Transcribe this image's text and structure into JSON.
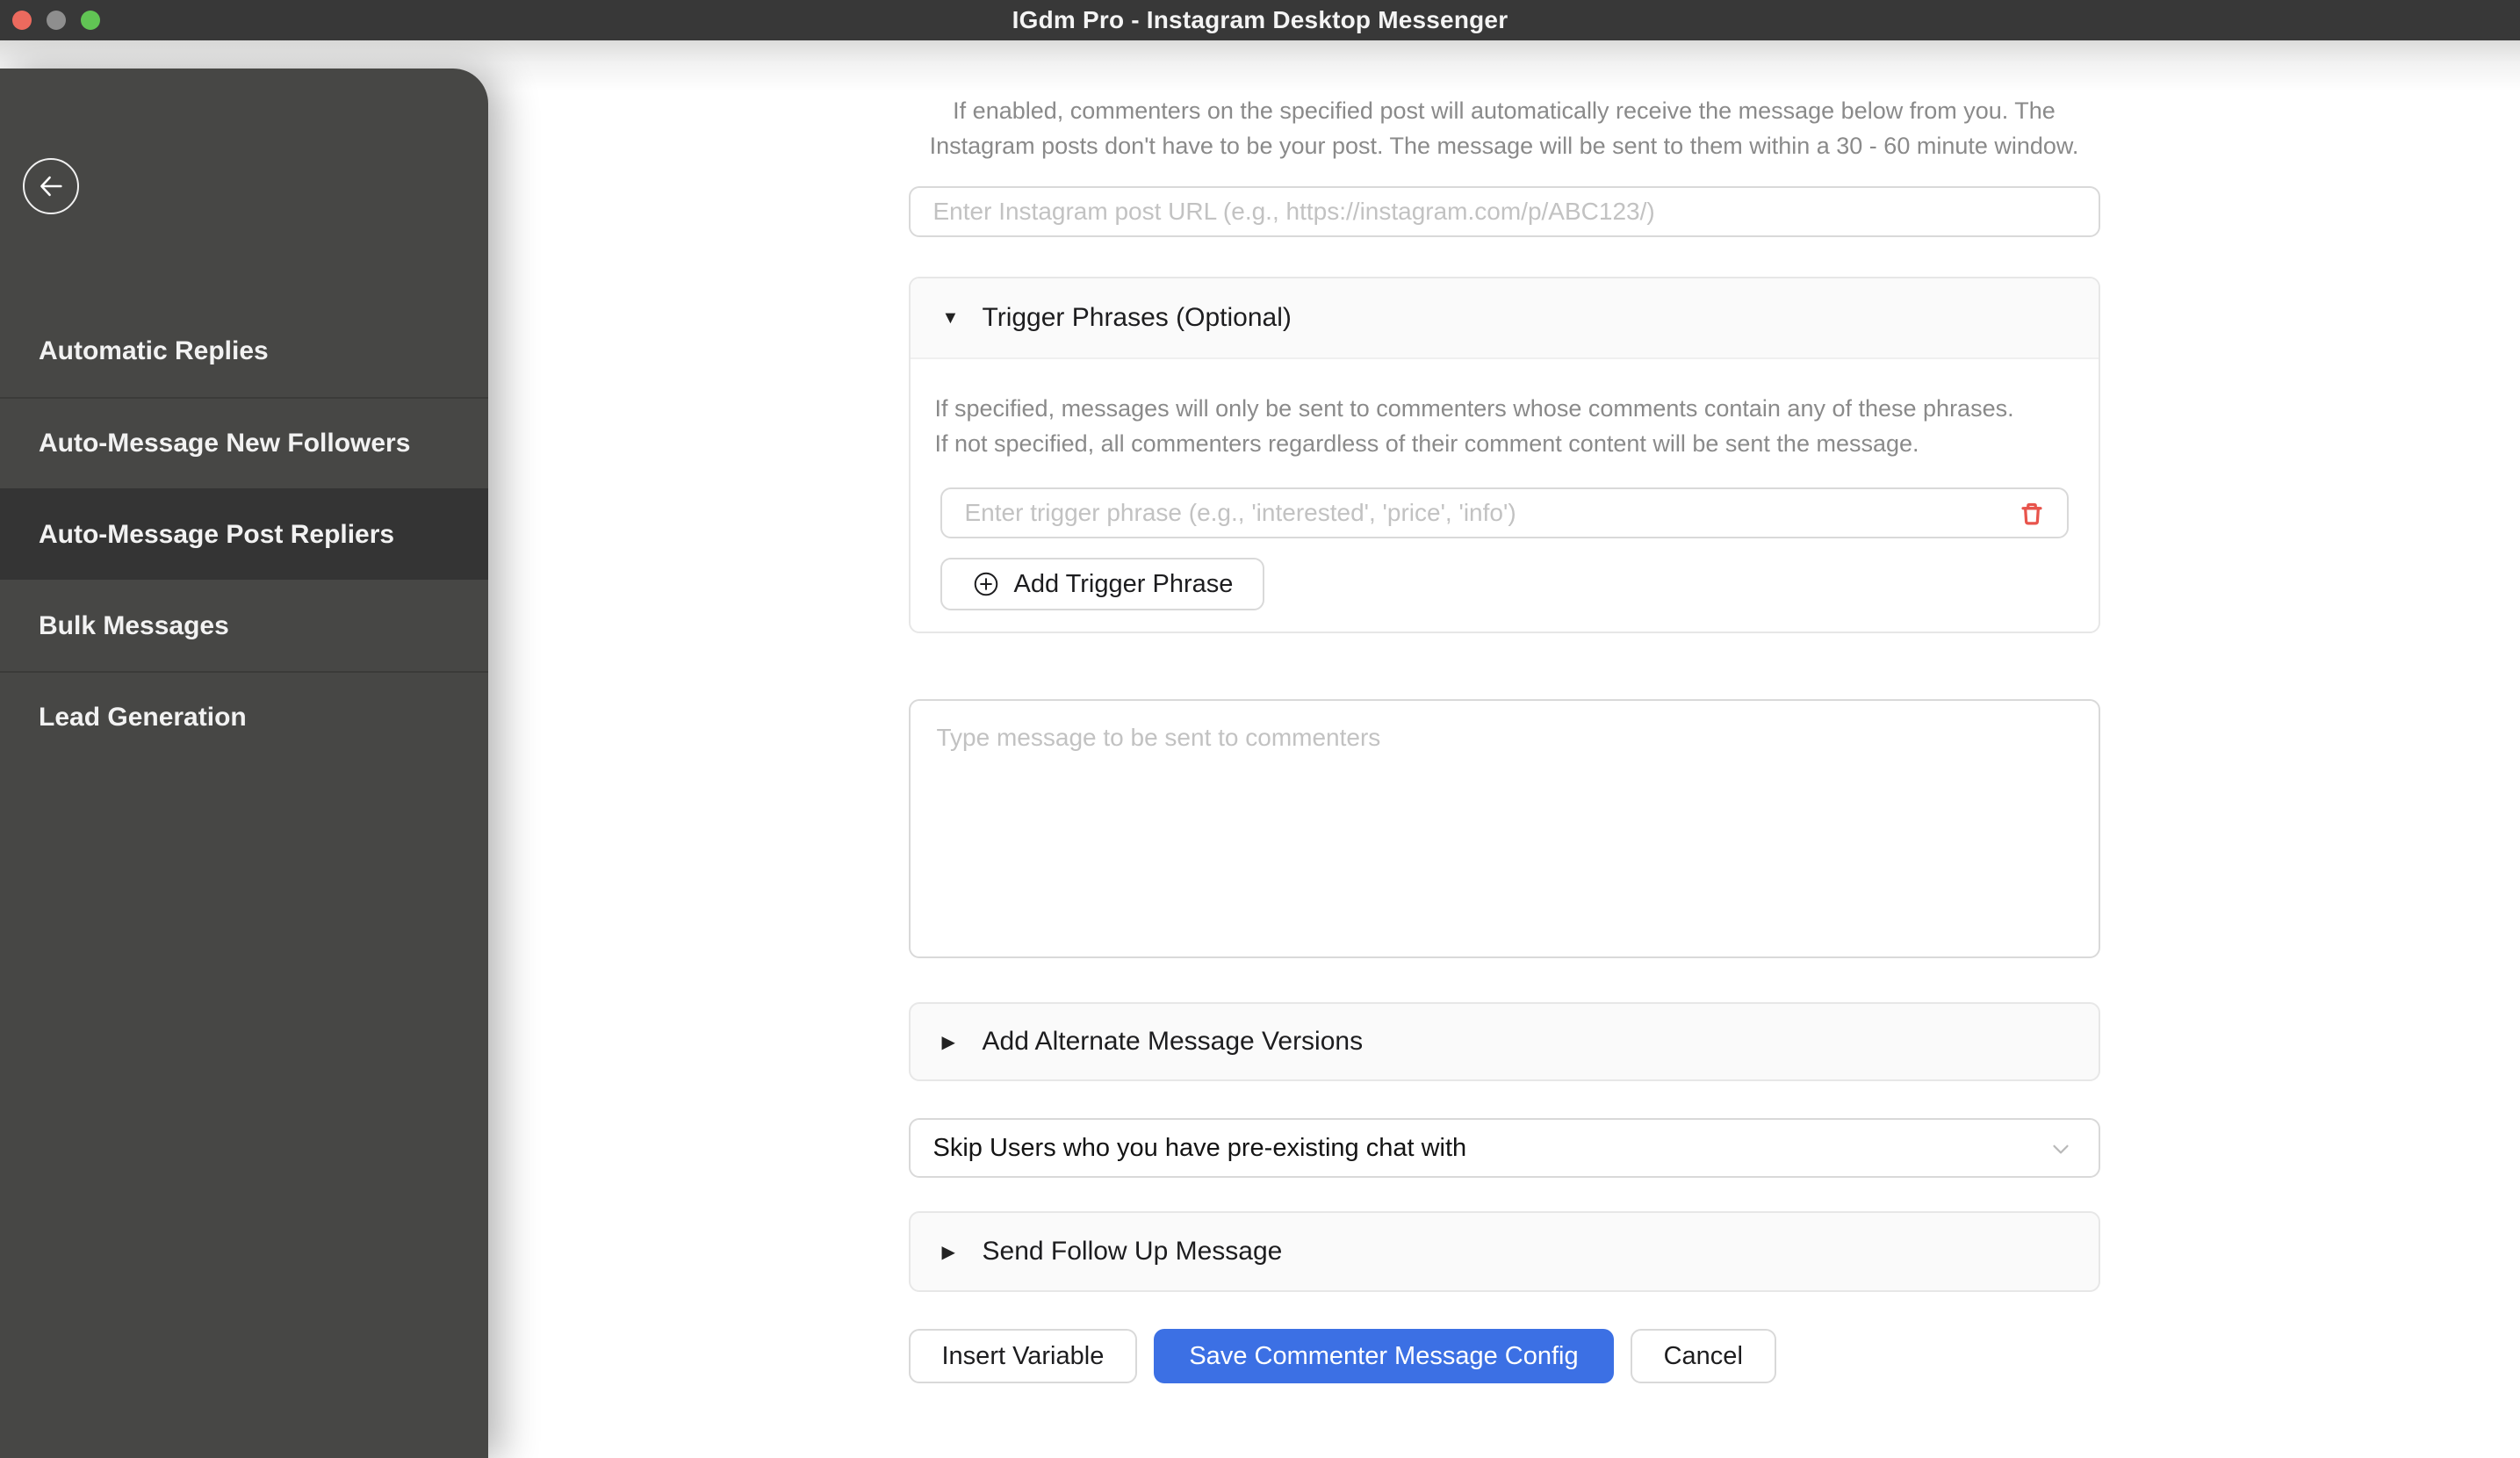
{
  "titlebar": {
    "title": "IGdm Pro - Instagram Desktop Messenger",
    "traffic_lights": {
      "close": "#ec6a5e",
      "minimize": "#8e8e8e",
      "zoom": "#61c454"
    }
  },
  "sidebar": {
    "back_icon": "left-arrow",
    "items": [
      {
        "label": "Automatic Replies",
        "selected": false
      },
      {
        "label": "Auto-Message New Followers",
        "selected": false
      },
      {
        "label": "Auto-Message Post Repliers",
        "selected": true
      },
      {
        "label": "Bulk Messages",
        "selected": false
      },
      {
        "label": "Lead Generation",
        "selected": false
      }
    ]
  },
  "main": {
    "intro": "If enabled, commenters on the specified post will automatically receive the message below from you. The Instagram posts don't have to be your post. The message will be sent to them within a 30 - 60 minute window.",
    "post_url_input": {
      "value": "",
      "placeholder": "Enter Instagram post URL (e.g., https://instagram.com/p/ABC123/)"
    },
    "trigger_section": {
      "expand_marker": "▼",
      "title": "Trigger Phrases (Optional)",
      "description": "If specified, messages will only be sent to commenters whose comments contain any of these phrases. If not specified, all commenters regardless of their comment content will be sent the message.",
      "phrase_input": {
        "value": "",
        "placeholder": "Enter trigger phrase (e.g., 'interested', 'price', 'info')"
      },
      "add_button_label": "Add Trigger Phrase"
    },
    "message_input": {
      "value": "",
      "placeholder": "Type message to be sent to commenters"
    },
    "alternate_section": {
      "expand_marker": "▶",
      "title": "Add Alternate Message Versions"
    },
    "skip_dropdown": {
      "value": "Skip Users who you have pre-existing chat with"
    },
    "followup_section": {
      "expand_marker": "▶",
      "title": "Send Follow Up Message"
    },
    "footer": {
      "insert_variable_label": "Insert Variable",
      "save_label": "Save Commenter Message Config",
      "cancel_label": "Cancel"
    }
  },
  "colors": {
    "accent_blue": "#3c70e4",
    "trash_red": "#e8544c",
    "titlebar_bg": "#383838",
    "sidebar_bg": "#474745",
    "sidebar_selected_bg": "#343434"
  }
}
